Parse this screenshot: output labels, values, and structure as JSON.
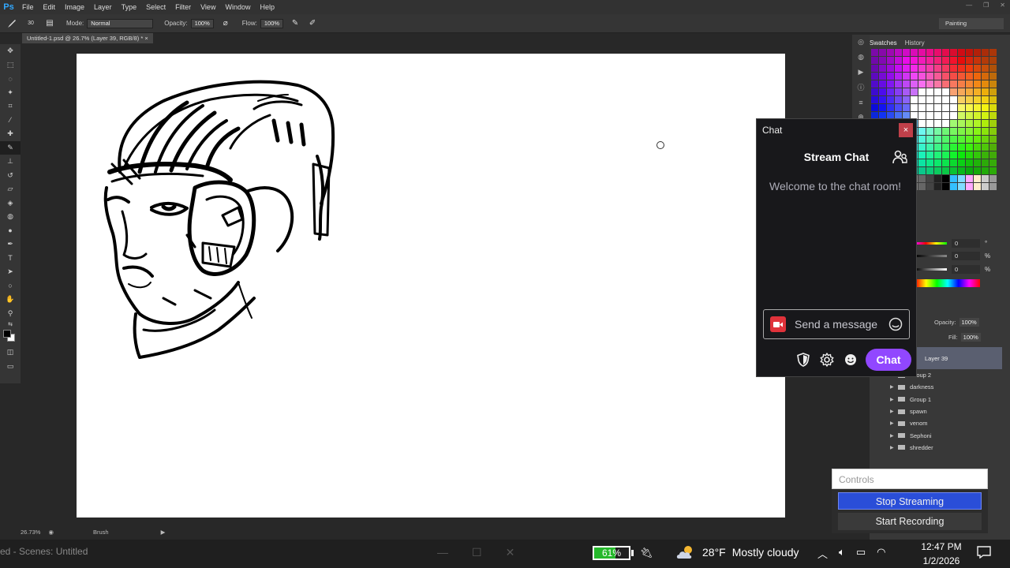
{
  "ps": {
    "logo": "Ps",
    "menu": [
      "File",
      "Edit",
      "Image",
      "Layer",
      "Type",
      "Select",
      "Filter",
      "View",
      "Window",
      "Help"
    ],
    "options": {
      "brush_size": "30",
      "mode_label": "Mode:",
      "mode_value": "Normal",
      "opacity_label": "Opacity:",
      "opacity_value": "100%",
      "flow_label": "Flow:",
      "flow_value": "100%"
    },
    "workspace": "Painting",
    "doc_tab": "Untitled-1.psd @ 26.7% (Layer 39, RGB/8) *",
    "status": {
      "zoom": "26.73%",
      "tool": "Brush"
    },
    "panels": {
      "tabs": [
        "Swatches",
        "History"
      ],
      "adjust_values": [
        "0",
        "0",
        "0"
      ],
      "adjust_units": [
        "°",
        "%",
        "%"
      ],
      "opacity_label": "Opacity:",
      "opacity_value": "100%",
      "fill_label": "Fill:",
      "fill_value": "100%"
    },
    "layers": {
      "selected": "Layer 39",
      "groups": [
        "Group 2",
        "darkness",
        "Group 1",
        "spawn",
        "venom",
        "Sephoni",
        "shredder"
      ]
    }
  },
  "chat": {
    "window_title": "Chat",
    "close_label": "×",
    "header": "Stream Chat",
    "welcome": "Welcome to the chat room!",
    "input_placeholder": "Send a message",
    "send_button": "Chat",
    "accent_color": "#9147ff"
  },
  "controls": {
    "title": "Controls",
    "stop_streaming": "Stop Streaming",
    "start_recording": "Start Recording"
  },
  "taskbar": {
    "obs_scenes": "ed - Scenes: Untitled",
    "battery_percent": 61,
    "battery_label": "61%",
    "temperature": "28°F",
    "weather": "Mostly cloudy",
    "time": "12:47 PM",
    "date": "1/2/2026"
  }
}
